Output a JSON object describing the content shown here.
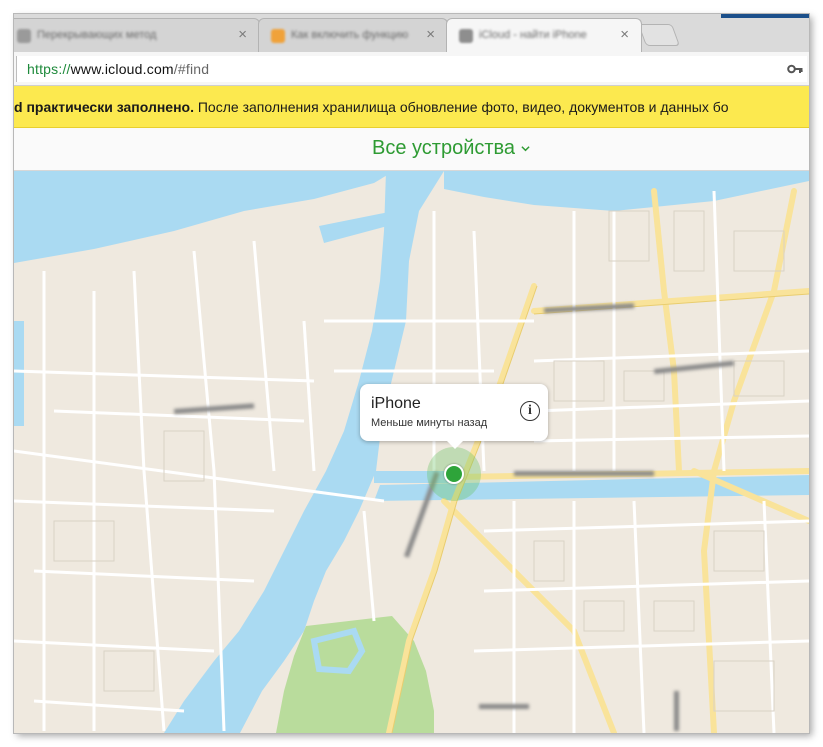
{
  "browser": {
    "tabs": [
      {
        "title": "Перекрывающих метод",
        "active": false
      },
      {
        "title": "Как включить функцию",
        "active": false
      },
      {
        "title": "iCloud - найти iPhone",
        "active": true
      }
    ],
    "tab_close_glyph": "×",
    "url": {
      "scheme": "https://",
      "host": "www.icloud.com",
      "path": "/#find"
    },
    "icons": {
      "key": "key-icon",
      "close": "close-icon",
      "chevron": "chevron-down-icon",
      "info": "info-icon"
    }
  },
  "banner": {
    "bold_text": "d практически заполнено.",
    "text": " После заполнения хранилища обновление фото, видео, документов и данных бо"
  },
  "header": {
    "devices_label": "Все устройства"
  },
  "map": {
    "device_callout": {
      "name": "iPhone",
      "status": "Меньше минуты назад",
      "info_glyph": "i"
    }
  },
  "colors": {
    "banner": "#fce94f",
    "accent_green": "#2e9b33",
    "water": "#aadaf2",
    "land": "#efe9df",
    "park": "#b9dc9c",
    "road": "#f9e39a"
  }
}
